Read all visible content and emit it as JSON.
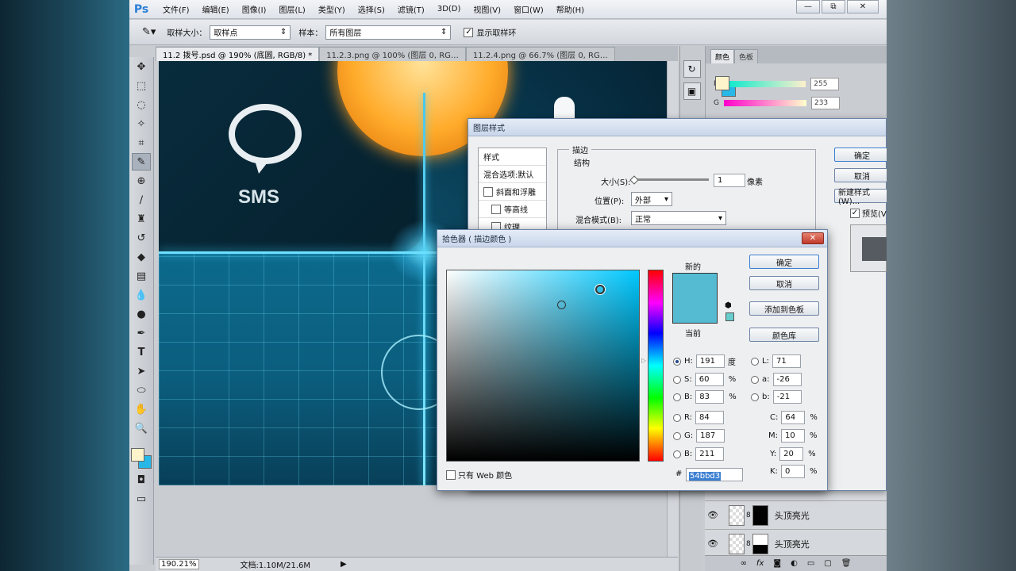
{
  "app": {
    "logo": "Ps",
    "menu": [
      "文件(F)",
      "编辑(E)",
      "图像(I)",
      "图层(L)",
      "类型(Y)",
      "选择(S)",
      "滤镜(T)",
      "3D(D)",
      "视图(V)",
      "窗口(W)",
      "帮助(H)"
    ],
    "window_buttons": [
      "—",
      "⧉",
      "✕"
    ]
  },
  "options": {
    "sample_size_label": "取样大小：",
    "sample_size_value": "取样点",
    "sample_label": "样本：",
    "sample_value": "所有图层",
    "show_ring_label": "显示取样环",
    "show_ring_checked": "✓"
  },
  "tabs": [
    "11.2 拨号.psd @ 190% (底圆, RGB/8) *",
    "11.2.3.png @ 100% (图层 0, RG…",
    "11.2.4.png @ 66.7% (图层 0, RG…"
  ],
  "canvas": {
    "sms_label": "SMS"
  },
  "status": {
    "zoom": "190.21%",
    "doc": "文档:1.10M/21.6M"
  },
  "color_panel": {
    "tabs": [
      "颜色",
      "色板"
    ],
    "rows": [
      {
        "label": "R",
        "value": "255"
      },
      {
        "label": "G",
        "value": "233"
      }
    ]
  },
  "layers": [
    {
      "name": "头顶亮光"
    },
    {
      "name": "头顶亮光"
    }
  ],
  "layer_style": {
    "title": "图层样式",
    "list": [
      "样式",
      "混合选项:默认",
      "斜面和浮雕",
      "等高线",
      "纹理"
    ],
    "section": "描边",
    "subsection": "结构",
    "size_label": "大小(S):",
    "size_value": "1",
    "size_unit": "像素",
    "position_label": "位置(P):",
    "position_value": "外部",
    "blend_label": "混合模式(B):",
    "blend_value": "正常",
    "buttons": [
      "确定",
      "取消",
      "新建样式(W)..."
    ],
    "preview_label": "预览(V)"
  },
  "picker": {
    "title": "拾色器 ( 描边颜色 )",
    "new_label": "新的",
    "current_label": "当前",
    "new_color": "#54bbd3",
    "current_color": "#54bbd3",
    "buttons": [
      "确定",
      "取消",
      "添加到色板",
      "颜色库"
    ],
    "H": "191",
    "H_unit": "度",
    "S": "60",
    "S_unit": "%",
    "B": "83",
    "B_unit": "%",
    "R": "84",
    "G": "187",
    "Bv": "211",
    "L": "71",
    "a": "-26",
    "b": "-21",
    "C": "64",
    "M": "10",
    "Y": "20",
    "K": "0",
    "pct": "%",
    "hex": "54bbd3",
    "web_only": "只有 Web 颜色"
  },
  "colors": {
    "fg": "#fdf4cc",
    "bg": "#27b8e8"
  }
}
